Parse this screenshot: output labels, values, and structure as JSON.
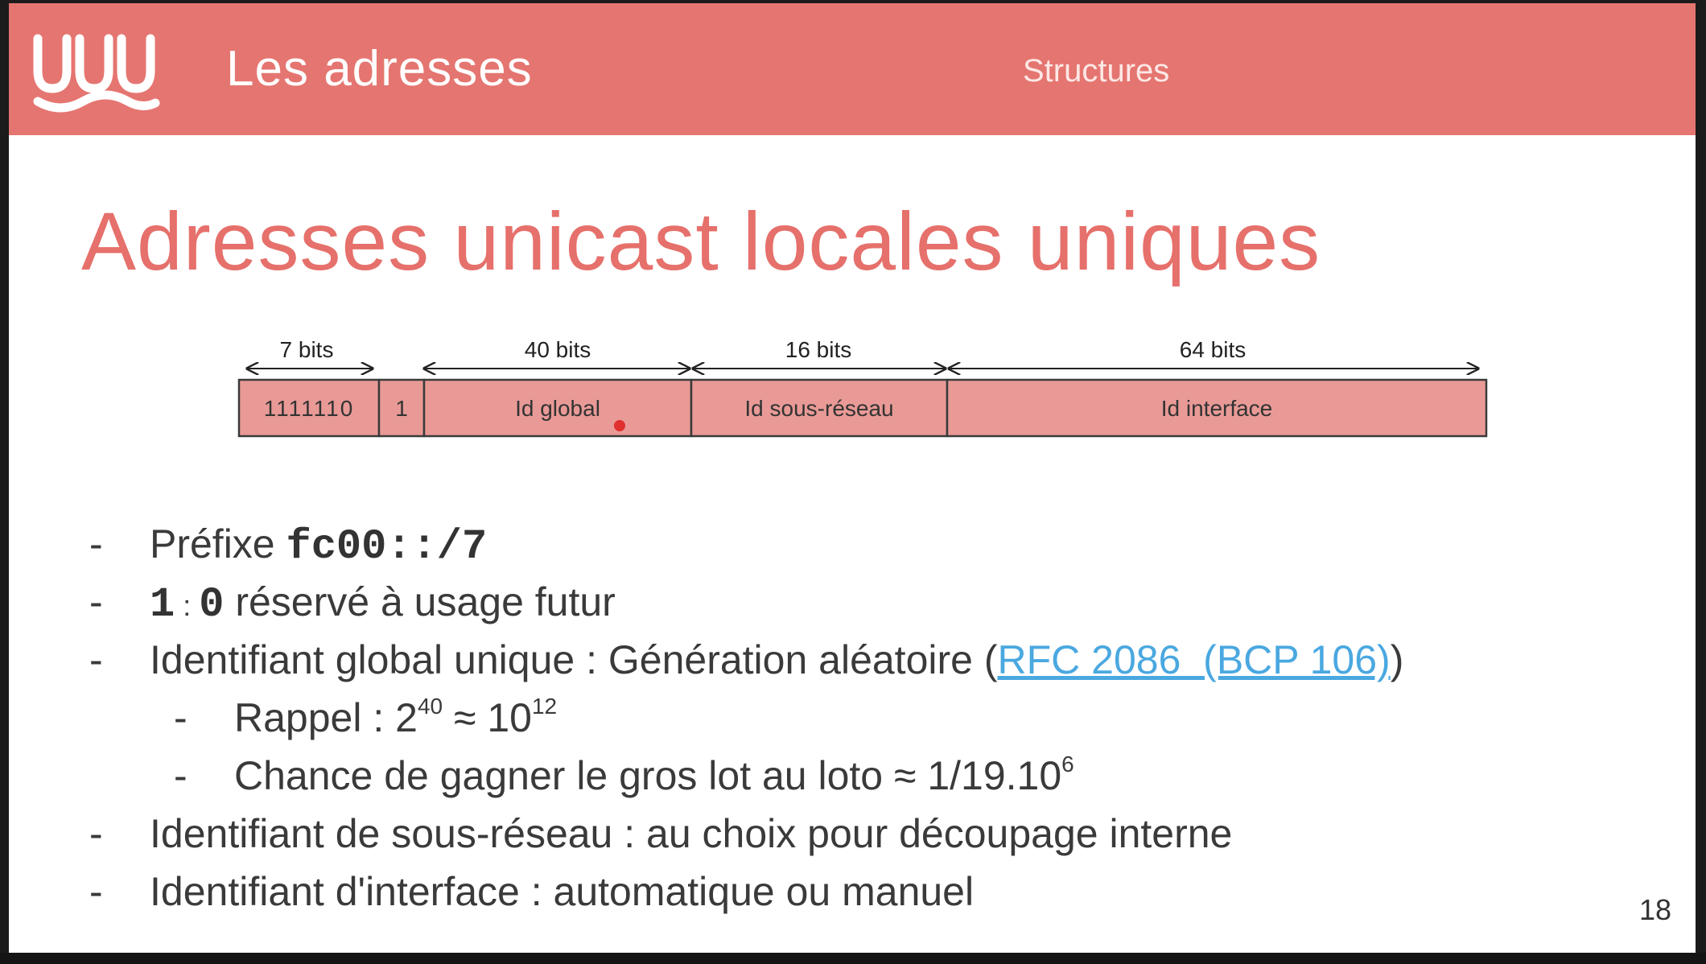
{
  "header": {
    "logo_icon": "wave-logo-icon",
    "title": "Les adresses",
    "section": "Structures",
    "background": "#e57570"
  },
  "slide": {
    "title": "Adresses unicast locales uniques",
    "title_color": "#e6706b",
    "page_number": "18"
  },
  "diagram": {
    "fill": "#e99a96",
    "fields": [
      {
        "label": "1111110",
        "bits": "7 bits"
      },
      {
        "label": "1",
        "bits": ""
      },
      {
        "label": "Id global",
        "bits": "40 bits"
      },
      {
        "label": "Id sous-réseau",
        "bits": "16 bits"
      },
      {
        "label": "Id interface",
        "bits": "64 bits"
      }
    ]
  },
  "bullets": {
    "b1": {
      "dash": "-",
      "text": "Préfixe ",
      "code": "fc00::/7"
    },
    "b2": {
      "dash": "-",
      "code_a": "1",
      "sep": " : ",
      "code_b": "0",
      "text": " réservé à usage futur"
    },
    "b3": {
      "dash": "-",
      "text": "Identifiant global unique : Génération aléatoire (",
      "link": "RFC 2086  (BCP 106)",
      "text_after": ")"
    },
    "b3_1": {
      "dash": "-",
      "text": "Rappel : 2",
      "sup1": "40",
      "text2": " ≈ 10",
      "sup2": "12"
    },
    "b3_2": {
      "dash": "-",
      "text": "Chance de gagner le gros lot au loto ≈ 1/19.10",
      "sup": "6"
    },
    "b4": {
      "dash": "-",
      "text": "Identifiant de sous-réseau : au choix pour découpage interne"
    },
    "b5": {
      "dash": "-",
      "text": "Identifiant d'interface : automatique ou manuel"
    }
  }
}
